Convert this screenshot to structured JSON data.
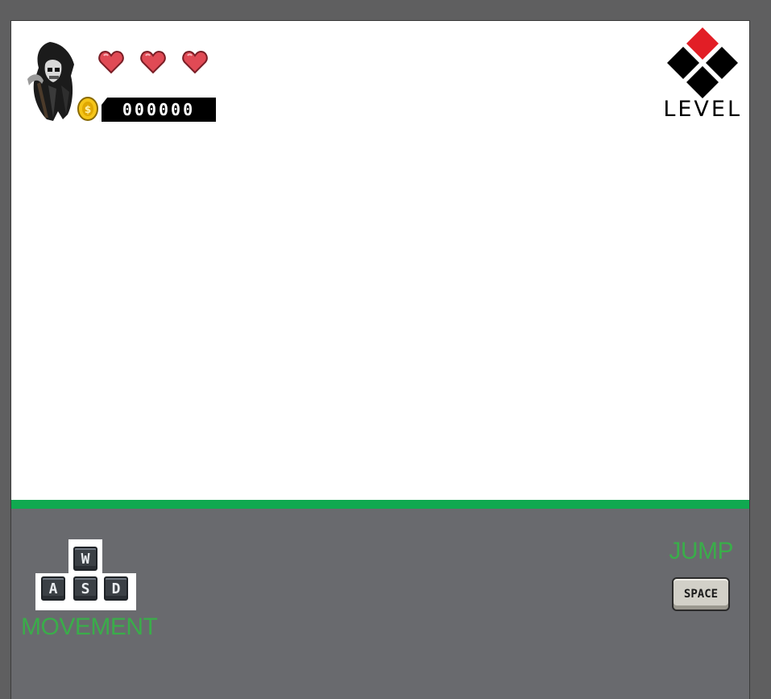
{
  "hud": {
    "lives": 3,
    "coins": "000000",
    "level_label": "LEVEL"
  },
  "controls": {
    "movement_keys": {
      "up": "W",
      "left": "A",
      "down": "S",
      "right": "D"
    },
    "movement_label": "MOVEMENT",
    "jump_label": "JUMP",
    "jump_key": "SPACE"
  },
  "colors": {
    "ground": "#10a950",
    "panel": "#696a6e",
    "accent_text": "#3aad4a",
    "heart": "#e04a55",
    "logo_red": "#e21e26"
  },
  "icons": {
    "player": "reaper-icon",
    "heart": "heart-icon",
    "coin": "coin-icon",
    "level": "diamond-logo-icon"
  }
}
